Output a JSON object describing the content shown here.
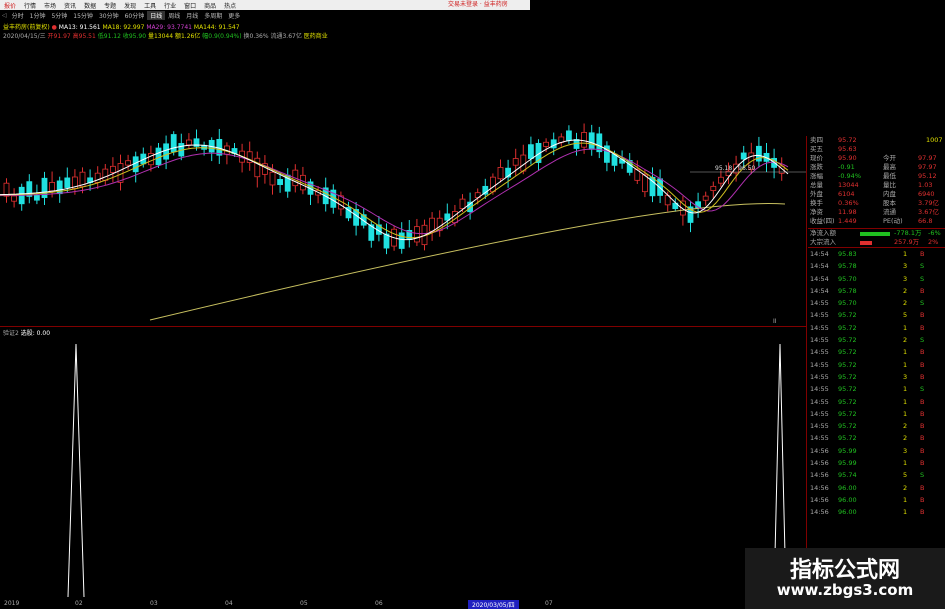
{
  "menubar": {
    "items": [
      "报价",
      "行情",
      "市场",
      "资讯",
      "数据",
      "专题",
      "发现",
      "工具",
      "行业",
      "窗口",
      "商品",
      "热点"
    ],
    "login": "交易未登录 · 益丰药房"
  },
  "tabbar": {
    "arrow": "◁",
    "tabs": [
      "分时",
      "1分钟",
      "5分钟",
      "15分钟",
      "30分钟",
      "60分钟",
      "日线",
      "周线",
      "月线",
      "多周期",
      "更多"
    ],
    "active_index": 6
  },
  "indicator_line": {
    "name": "益丰药房(前复权)",
    "dot": "●",
    "ma13": "MA13: 91.561",
    "ma18": "MA18: 92.997",
    "ma29": "MA29: 93.7741",
    "ma144": "MA144: 91.547"
  },
  "info_line": {
    "date": "2020/04/15/三",
    "open": "开91.97",
    "high": "高95.51",
    "low": "低91.12",
    "close": "收95.90",
    "vol": "量13044",
    "amount": "额1.26亿",
    "change": "幅0.9(0.94%)",
    "turnover": "换0.36%",
    "float": "流通3.67亿",
    "sector": "医药商业"
  },
  "chart_label": "95.18 - 96.50",
  "sub_header": {
    "name": "验证2",
    "param": "选股: 0.00"
  },
  "quote_panel": {
    "rows": [
      {
        "label": "卖四",
        "value": "95.72",
        "vol": "1007"
      },
      {
        "label": "买五",
        "value": "95.63",
        "vol": ""
      },
      {
        "label": "现价",
        "value": "95.90",
        "label2": "今开",
        "value2": "97.97"
      },
      {
        "label": "涨跌",
        "value": "-0.91",
        "label2": "最高",
        "value2": "97.97"
      },
      {
        "label": "涨幅",
        "value": "-0.94%",
        "label2": "最低",
        "value2": "95.12"
      },
      {
        "label": "总量",
        "value": "13044",
        "label2": "量比",
        "value2": "1.03"
      },
      {
        "label": "外盘",
        "value": "6104",
        "label2": "内盘",
        "value2": "6940"
      },
      {
        "label": "换手",
        "value": "0.36%",
        "label2": "股本",
        "value2": "3.79亿"
      },
      {
        "label": "净资",
        "value": "11.98",
        "label2": "流通",
        "value2": "3.67亿"
      },
      {
        "label": "收益(四)",
        "value": "1.449",
        "label2": "PE(动)",
        "value2": "66.8"
      }
    ],
    "flow": [
      {
        "label": "净流入额",
        "value": "-778.1万",
        "pct": "-6%"
      },
      {
        "label": "大宗流入",
        "value": "257.9万",
        "pct": "2%"
      }
    ],
    "ticks": [
      {
        "t": "14:54",
        "p": "95.83",
        "v": "1",
        "s": "B"
      },
      {
        "t": "14:54",
        "p": "95.78",
        "v": "3",
        "s": "S"
      },
      {
        "t": "14:54",
        "p": "95.70",
        "v": "3",
        "s": "S"
      },
      {
        "t": "14:54",
        "p": "95.78",
        "v": "2",
        "s": "B"
      },
      {
        "t": "14:55",
        "p": "95.70",
        "v": "2",
        "s": "S"
      },
      {
        "t": "14:55",
        "p": "95.72",
        "v": "5",
        "s": "B"
      },
      {
        "t": "14:55",
        "p": "95.72",
        "v": "1",
        "s": "B"
      },
      {
        "t": "14:55",
        "p": "95.72",
        "v": "2",
        "s": "S"
      },
      {
        "t": "14:55",
        "p": "95.72",
        "v": "1",
        "s": "B"
      },
      {
        "t": "14:55",
        "p": "95.72",
        "v": "1",
        "s": "B"
      },
      {
        "t": "14:55",
        "p": "95.72",
        "v": "3",
        "s": "B"
      },
      {
        "t": "14:55",
        "p": "95.72",
        "v": "1",
        "s": "S"
      },
      {
        "t": "14:55",
        "p": "95.72",
        "v": "1",
        "s": "B"
      },
      {
        "t": "14:55",
        "p": "95.72",
        "v": "1",
        "s": "B"
      },
      {
        "t": "14:55",
        "p": "95.72",
        "v": "2",
        "s": "B"
      },
      {
        "t": "14:55",
        "p": "95.72",
        "v": "2",
        "s": "B"
      },
      {
        "t": "14:56",
        "p": "95.99",
        "v": "3",
        "s": "B"
      },
      {
        "t": "14:56",
        "p": "95.99",
        "v": "1",
        "s": "B"
      },
      {
        "t": "14:56",
        "p": "95.74",
        "v": "5",
        "s": "S"
      },
      {
        "t": "14:56",
        "p": "96.00",
        "v": "2",
        "s": "B"
      },
      {
        "t": "14:56",
        "p": "96.00",
        "v": "1",
        "s": "B"
      },
      {
        "t": "14:56",
        "p": "96.00",
        "v": "1",
        "s": "B"
      }
    ]
  },
  "bottom_dates": [
    "2019",
    "02",
    "03",
    "04",
    "05",
    "06",
    "07"
  ],
  "bottom_selected_date": "2020/03/05/四",
  "watermark": {
    "line1": "指标公式网",
    "line2": "www.zbgs3.com"
  },
  "pause_icon": "II",
  "colors": {
    "up": "#e03030",
    "down": "#20e0e0",
    "ma13": "#ffffff",
    "ma18": "#e0e000",
    "ma29": "#d040d0",
    "ma144": "#c8c060"
  }
}
